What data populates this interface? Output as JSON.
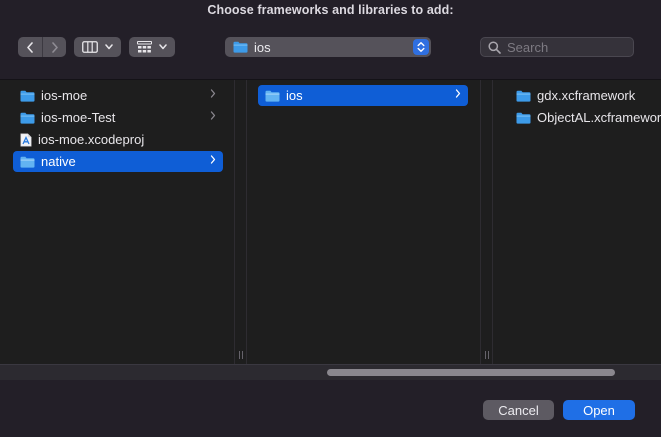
{
  "dialog": {
    "title": "Choose frameworks and libraries to add:"
  },
  "toolbar": {
    "back_icon": "chevron-left-icon",
    "forward_icon": "chevron-right-icon",
    "view_icon": "column-view-icon",
    "group_icon": "grid-view-icon",
    "location": "ios",
    "search_placeholder": "Search"
  },
  "columns": [
    {
      "items": [
        {
          "label": "ios-moe",
          "icon": "folder-icon",
          "has_children": true,
          "selected": false
        },
        {
          "label": "ios-moe-Test",
          "icon": "folder-icon",
          "has_children": true,
          "selected": false
        },
        {
          "label": "ios-moe.xcodeproj",
          "icon": "xcode-project-icon",
          "has_children": false,
          "selected": false
        },
        {
          "label": "native",
          "icon": "folder-icon",
          "has_children": true,
          "selected": true
        }
      ]
    },
    {
      "items": [
        {
          "label": "ios",
          "icon": "folder-icon",
          "has_children": true,
          "selected": true
        }
      ]
    },
    {
      "items": [
        {
          "label": "gdx.xcframework",
          "icon": "folder-icon",
          "has_children": false,
          "selected": false
        },
        {
          "label": "ObjectAL.xcframework",
          "icon": "folder-icon",
          "has_children": false,
          "selected": false
        }
      ]
    }
  ],
  "buttons": {
    "cancel": "Cancel",
    "open": "Open"
  },
  "colors": {
    "accent": "#0f5ed6",
    "folder": "#3d9be9",
    "background": "#231f28"
  }
}
